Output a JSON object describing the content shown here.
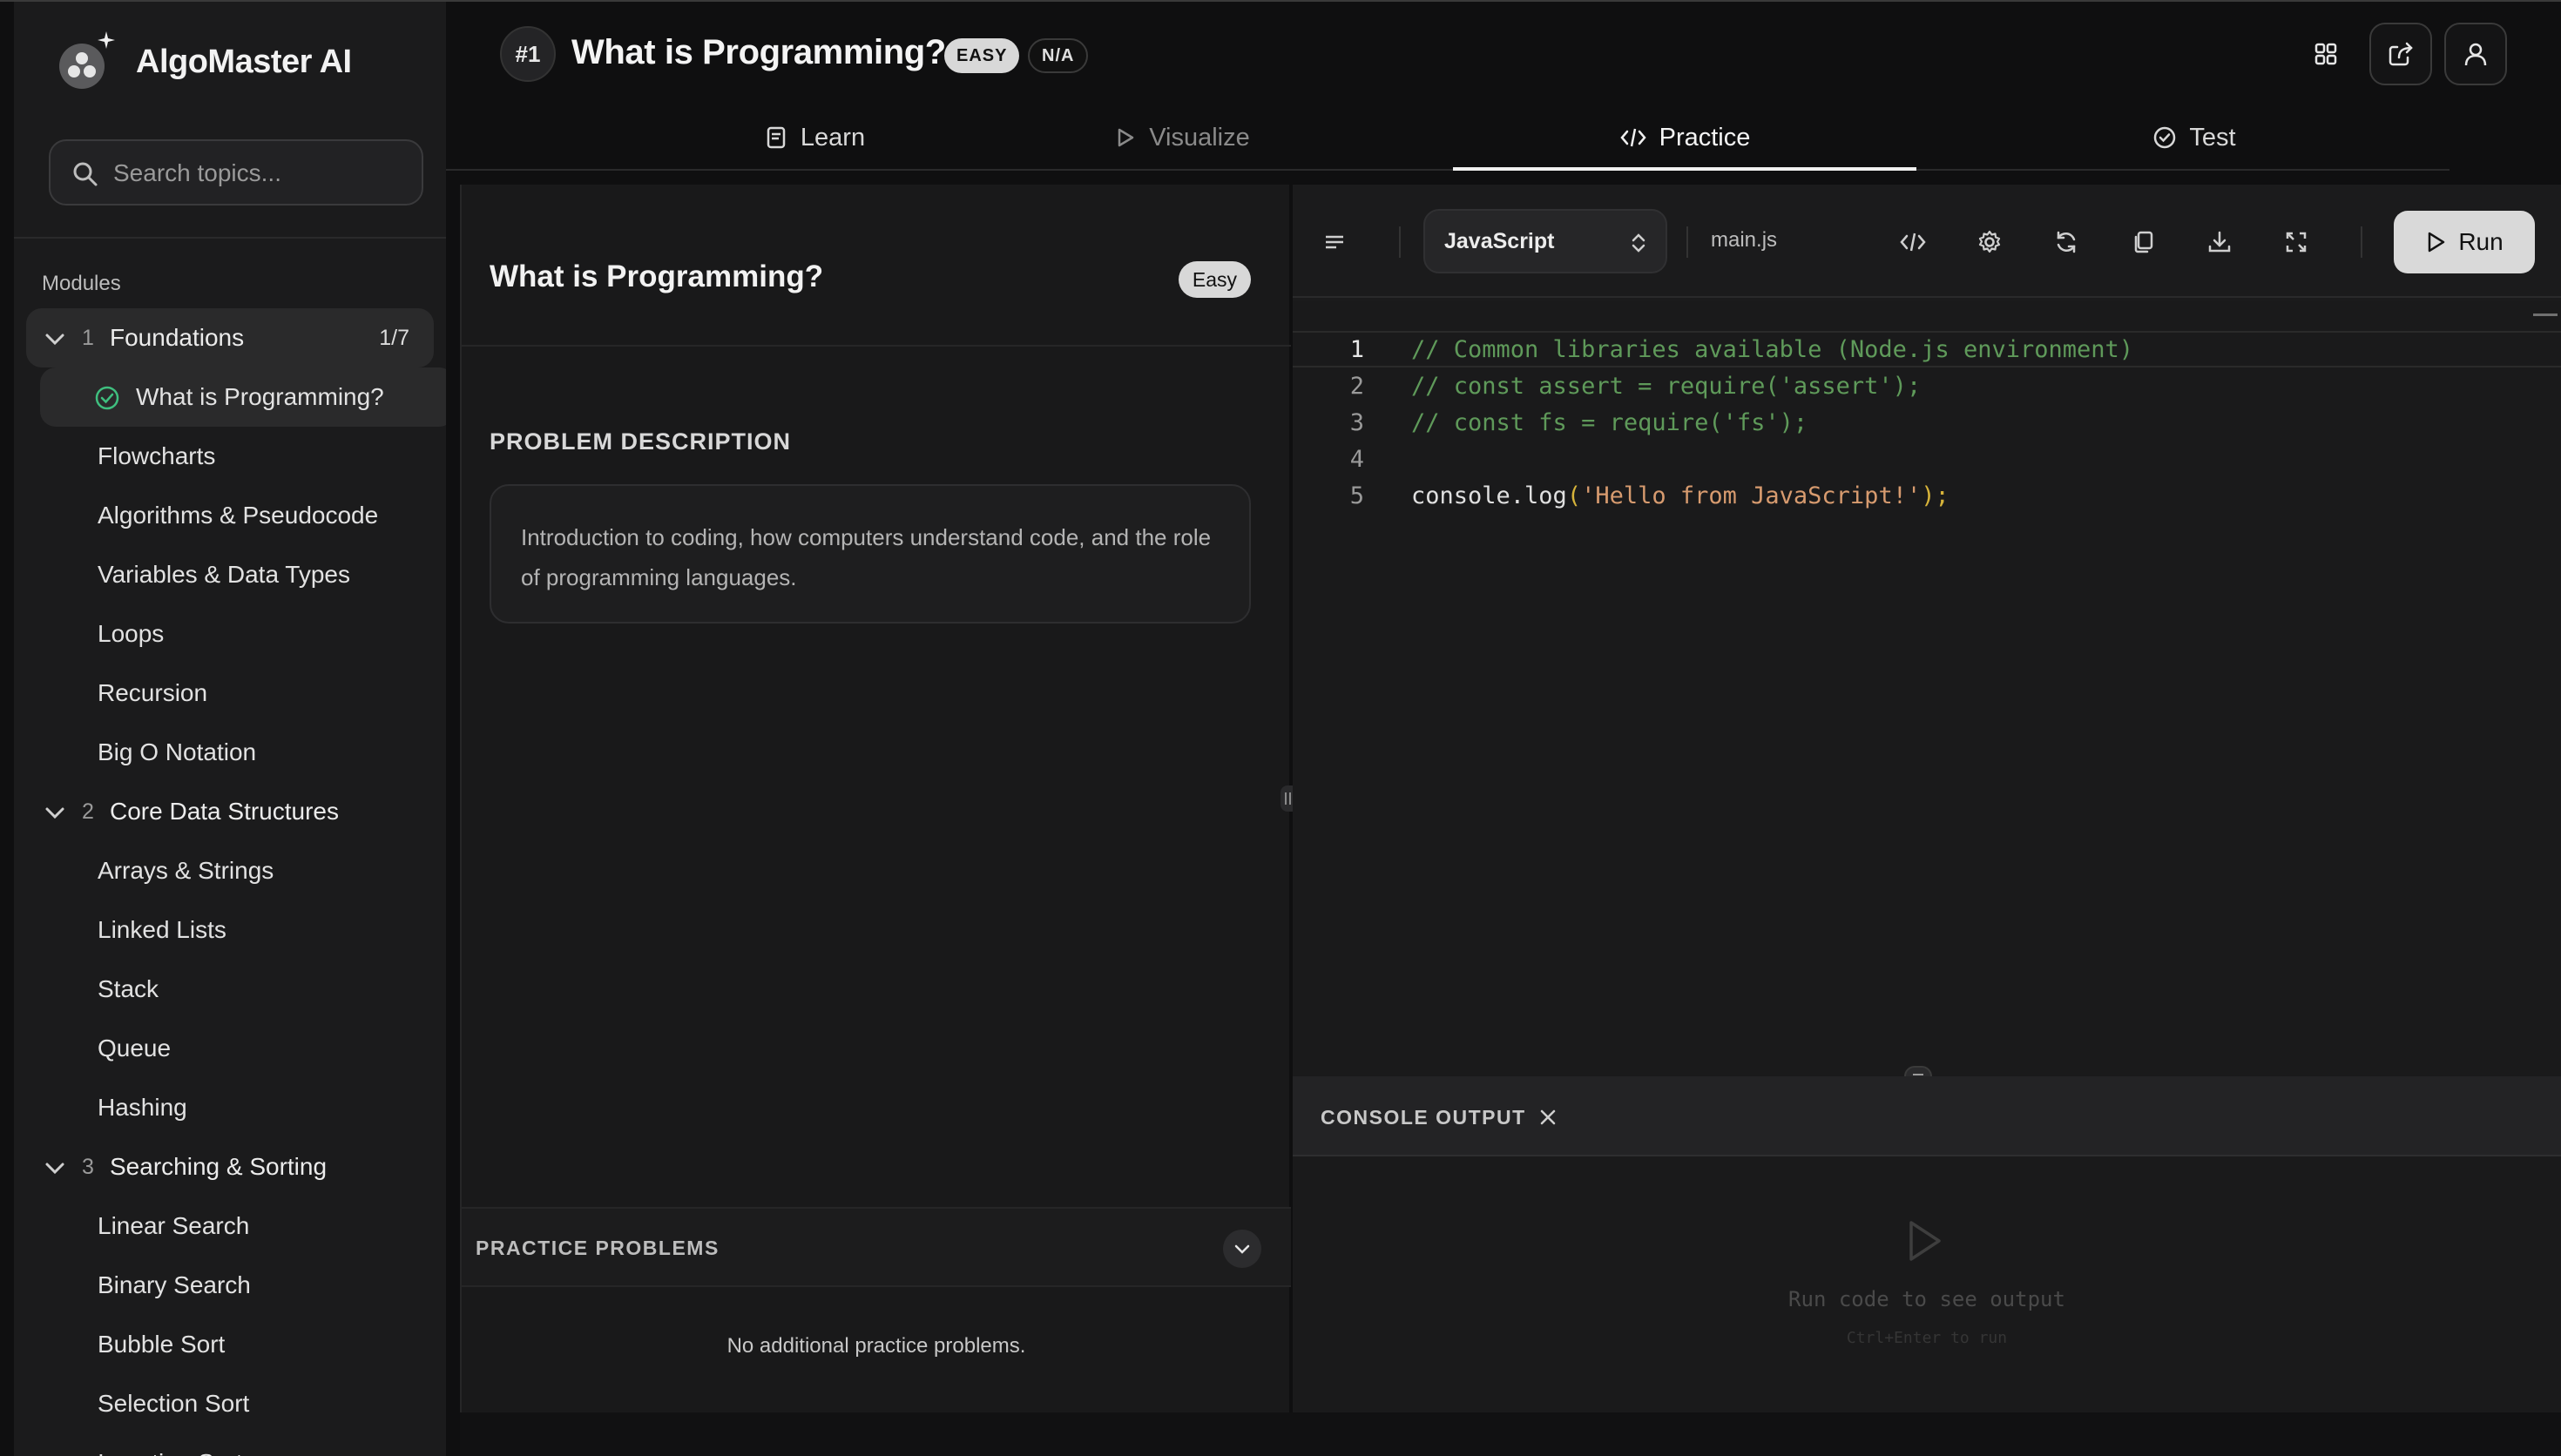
{
  "brand": {
    "name": "AlgoMaster AI"
  },
  "search": {
    "placeholder": "Search topics..."
  },
  "sidebar": {
    "modules_label": "Modules",
    "modules": [
      {
        "num": "1",
        "title": "Foundations",
        "count": "1/7",
        "expanded": true,
        "lessons": [
          "What is Programming?",
          "Flowcharts",
          "Algorithms & Pseudocode",
          "Variables & Data Types",
          "Loops",
          "Recursion",
          "Big O Notation"
        ]
      },
      {
        "num": "2",
        "title": "Core Data Structures",
        "expanded": true,
        "lessons": [
          "Arrays & Strings",
          "Linked Lists",
          "Stack",
          "Queue",
          "Hashing"
        ]
      },
      {
        "num": "3",
        "title": "Searching & Sorting",
        "expanded": true,
        "lessons": [
          "Linear Search",
          "Binary Search",
          "Bubble Sort",
          "Selection Sort",
          "Insertion Sort"
        ]
      }
    ],
    "active_lesson": "What is Programming?"
  },
  "header": {
    "number": "#1",
    "title": "What is Programming?",
    "difficulty_badge": "EASY",
    "status_badge": "N/A"
  },
  "tabs": [
    {
      "label": "Learn",
      "icon": "notes-icon",
      "state": "inactive"
    },
    {
      "label": "Visualize",
      "icon": "play-icon",
      "state": "disabled"
    },
    {
      "label": "Practice",
      "icon": "code-icon",
      "state": "active"
    },
    {
      "label": "Test",
      "icon": "check-circle-icon",
      "state": "inactive"
    }
  ],
  "problem": {
    "title": "What is Programming?",
    "difficulty": "Easy",
    "description_label": "PROBLEM DESCRIPTION",
    "description": "Introduction to coding, how computers understand code, and the role of programming languages."
  },
  "practice": {
    "label": "PRACTICE PROBLEMS",
    "empty_text": "No additional practice problems."
  },
  "editor": {
    "language": "JavaScript",
    "filename": "main.js",
    "run_label": "Run",
    "lines": [
      {
        "n": "1",
        "text": "// Common libraries available (Node.js environment)"
      },
      {
        "n": "2",
        "text": "// const assert = require('assert');"
      },
      {
        "n": "3",
        "text": "// const fs = require('fs');"
      },
      {
        "n": "4",
        "text": ""
      },
      {
        "n": "5",
        "text": "console.log('Hello from JavaScript!');"
      }
    ],
    "toolbar_icons": [
      "menu-icon",
      "code-view-icon",
      "settings-icon",
      "reset-icon",
      "copy-icon",
      "download-icon",
      "fullscreen-icon"
    ]
  },
  "console": {
    "label": "CONSOLE OUTPUT",
    "hint": "Run code to see output",
    "shortcut": "Ctrl+Enter to run"
  },
  "colors": {
    "background": "#0f0f10",
    "panel": "#1b1b1c",
    "comment": "#5f9a5a",
    "string": "#d79b6f",
    "success": "#3fbf7f"
  }
}
